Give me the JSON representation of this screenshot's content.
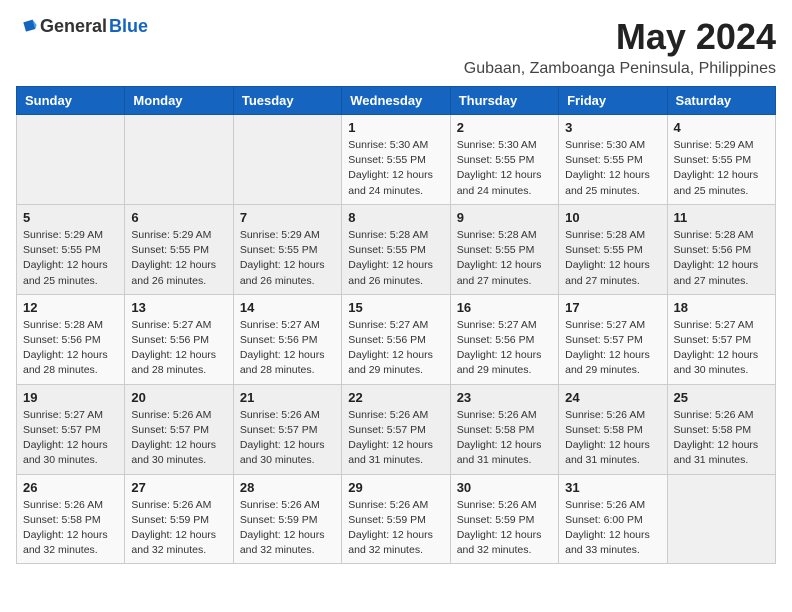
{
  "logo": {
    "general": "General",
    "blue": "Blue"
  },
  "title": "May 2024",
  "subtitle": "Gubaan, Zamboanga Peninsula, Philippines",
  "days_header": [
    "Sunday",
    "Monday",
    "Tuesday",
    "Wednesday",
    "Thursday",
    "Friday",
    "Saturday"
  ],
  "weeks": [
    [
      {
        "day": "",
        "info": ""
      },
      {
        "day": "",
        "info": ""
      },
      {
        "day": "",
        "info": ""
      },
      {
        "day": "1",
        "info": "Sunrise: 5:30 AM\nSunset: 5:55 PM\nDaylight: 12 hours\nand 24 minutes."
      },
      {
        "day": "2",
        "info": "Sunrise: 5:30 AM\nSunset: 5:55 PM\nDaylight: 12 hours\nand 24 minutes."
      },
      {
        "day": "3",
        "info": "Sunrise: 5:30 AM\nSunset: 5:55 PM\nDaylight: 12 hours\nand 25 minutes."
      },
      {
        "day": "4",
        "info": "Sunrise: 5:29 AM\nSunset: 5:55 PM\nDaylight: 12 hours\nand 25 minutes."
      }
    ],
    [
      {
        "day": "5",
        "info": "Sunrise: 5:29 AM\nSunset: 5:55 PM\nDaylight: 12 hours\nand 25 minutes."
      },
      {
        "day": "6",
        "info": "Sunrise: 5:29 AM\nSunset: 5:55 PM\nDaylight: 12 hours\nand 26 minutes."
      },
      {
        "day": "7",
        "info": "Sunrise: 5:29 AM\nSunset: 5:55 PM\nDaylight: 12 hours\nand 26 minutes."
      },
      {
        "day": "8",
        "info": "Sunrise: 5:28 AM\nSunset: 5:55 PM\nDaylight: 12 hours\nand 26 minutes."
      },
      {
        "day": "9",
        "info": "Sunrise: 5:28 AM\nSunset: 5:55 PM\nDaylight: 12 hours\nand 27 minutes."
      },
      {
        "day": "10",
        "info": "Sunrise: 5:28 AM\nSunset: 5:55 PM\nDaylight: 12 hours\nand 27 minutes."
      },
      {
        "day": "11",
        "info": "Sunrise: 5:28 AM\nSunset: 5:56 PM\nDaylight: 12 hours\nand 27 minutes."
      }
    ],
    [
      {
        "day": "12",
        "info": "Sunrise: 5:28 AM\nSunset: 5:56 PM\nDaylight: 12 hours\nand 28 minutes."
      },
      {
        "day": "13",
        "info": "Sunrise: 5:27 AM\nSunset: 5:56 PM\nDaylight: 12 hours\nand 28 minutes."
      },
      {
        "day": "14",
        "info": "Sunrise: 5:27 AM\nSunset: 5:56 PM\nDaylight: 12 hours\nand 28 minutes."
      },
      {
        "day": "15",
        "info": "Sunrise: 5:27 AM\nSunset: 5:56 PM\nDaylight: 12 hours\nand 29 minutes."
      },
      {
        "day": "16",
        "info": "Sunrise: 5:27 AM\nSunset: 5:56 PM\nDaylight: 12 hours\nand 29 minutes."
      },
      {
        "day": "17",
        "info": "Sunrise: 5:27 AM\nSunset: 5:57 PM\nDaylight: 12 hours\nand 29 minutes."
      },
      {
        "day": "18",
        "info": "Sunrise: 5:27 AM\nSunset: 5:57 PM\nDaylight: 12 hours\nand 30 minutes."
      }
    ],
    [
      {
        "day": "19",
        "info": "Sunrise: 5:27 AM\nSunset: 5:57 PM\nDaylight: 12 hours\nand 30 minutes."
      },
      {
        "day": "20",
        "info": "Sunrise: 5:26 AM\nSunset: 5:57 PM\nDaylight: 12 hours\nand 30 minutes."
      },
      {
        "day": "21",
        "info": "Sunrise: 5:26 AM\nSunset: 5:57 PM\nDaylight: 12 hours\nand 30 minutes."
      },
      {
        "day": "22",
        "info": "Sunrise: 5:26 AM\nSunset: 5:57 PM\nDaylight: 12 hours\nand 31 minutes."
      },
      {
        "day": "23",
        "info": "Sunrise: 5:26 AM\nSunset: 5:58 PM\nDaylight: 12 hours\nand 31 minutes."
      },
      {
        "day": "24",
        "info": "Sunrise: 5:26 AM\nSunset: 5:58 PM\nDaylight: 12 hours\nand 31 minutes."
      },
      {
        "day": "25",
        "info": "Sunrise: 5:26 AM\nSunset: 5:58 PM\nDaylight: 12 hours\nand 31 minutes."
      }
    ],
    [
      {
        "day": "26",
        "info": "Sunrise: 5:26 AM\nSunset: 5:58 PM\nDaylight: 12 hours\nand 32 minutes."
      },
      {
        "day": "27",
        "info": "Sunrise: 5:26 AM\nSunset: 5:59 PM\nDaylight: 12 hours\nand 32 minutes."
      },
      {
        "day": "28",
        "info": "Sunrise: 5:26 AM\nSunset: 5:59 PM\nDaylight: 12 hours\nand 32 minutes."
      },
      {
        "day": "29",
        "info": "Sunrise: 5:26 AM\nSunset: 5:59 PM\nDaylight: 12 hours\nand 32 minutes."
      },
      {
        "day": "30",
        "info": "Sunrise: 5:26 AM\nSunset: 5:59 PM\nDaylight: 12 hours\nand 32 minutes."
      },
      {
        "day": "31",
        "info": "Sunrise: 5:26 AM\nSunset: 6:00 PM\nDaylight: 12 hours\nand 33 minutes."
      },
      {
        "day": "",
        "info": ""
      }
    ]
  ]
}
